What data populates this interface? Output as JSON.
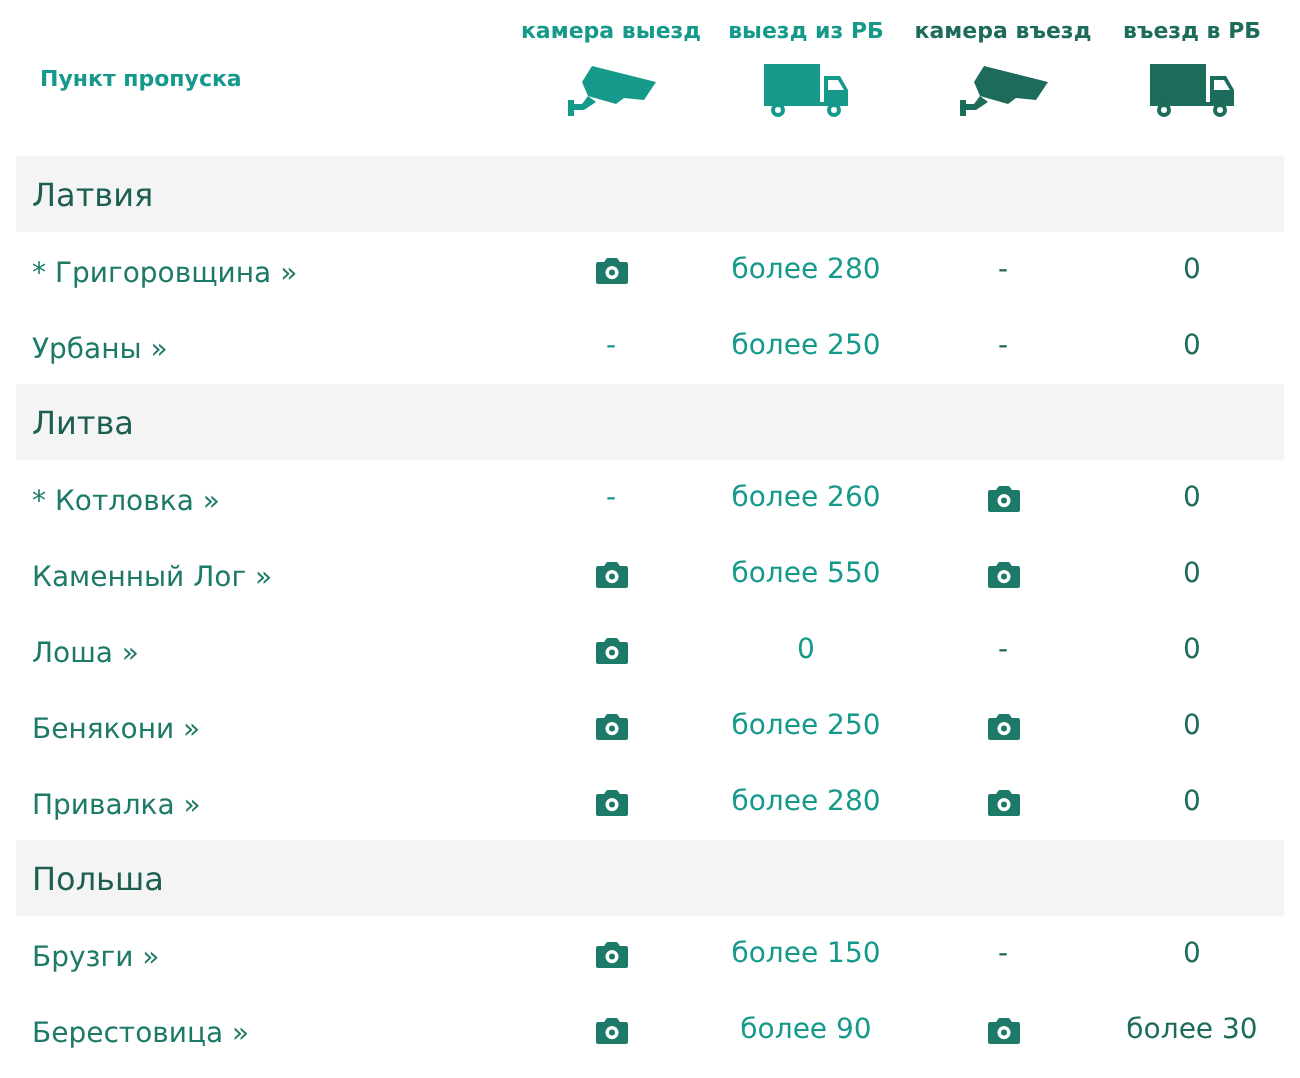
{
  "table": {
    "columns": [
      {
        "label": "Пункт пропуска",
        "kind": "name"
      },
      {
        "label": "камера выезд",
        "kind": "camera",
        "color": "#14998a"
      },
      {
        "label": "выезд из РБ",
        "kind": "truck",
        "color": "#14998a"
      },
      {
        "label": "камера въезд",
        "kind": "camera",
        "color": "#1d6b5a"
      },
      {
        "label": "въезд в РБ",
        "kind": "truck",
        "color": "#1d6b5a"
      }
    ],
    "groups": [
      {
        "name": "Латвия",
        "rows": [
          {
            "name": "* Григоровщина »",
            "cells": [
              {
                "kind": "camera"
              },
              {
                "kind": "text",
                "text": "более 280"
              },
              {
                "kind": "text",
                "text": "-"
              },
              {
                "kind": "text",
                "text": "0"
              }
            ]
          },
          {
            "name": "Урбаны »",
            "cells": [
              {
                "kind": "text",
                "text": "-"
              },
              {
                "kind": "text",
                "text": "более 250"
              },
              {
                "kind": "text",
                "text": "-"
              },
              {
                "kind": "text",
                "text": "0"
              }
            ]
          }
        ]
      },
      {
        "name": "Литва",
        "rows": [
          {
            "name": "* Котловка »",
            "cells": [
              {
                "kind": "text",
                "text": "-"
              },
              {
                "kind": "text",
                "text": "более 260"
              },
              {
                "kind": "camera"
              },
              {
                "kind": "text",
                "text": "0"
              }
            ]
          },
          {
            "name": "Каменный Лог »",
            "cells": [
              {
                "kind": "camera"
              },
              {
                "kind": "text",
                "text": "более 550"
              },
              {
                "kind": "camera"
              },
              {
                "kind": "text",
                "text": "0"
              }
            ]
          },
          {
            "name": "Лоша »",
            "cells": [
              {
                "kind": "camera"
              },
              {
                "kind": "text",
                "text": "0"
              },
              {
                "kind": "text",
                "text": "-"
              },
              {
                "kind": "text",
                "text": "0"
              }
            ]
          },
          {
            "name": "Бенякони »",
            "cells": [
              {
                "kind": "camera"
              },
              {
                "kind": "text",
                "text": "более 250"
              },
              {
                "kind": "camera"
              },
              {
                "kind": "text",
                "text": "0"
              }
            ]
          },
          {
            "name": "Привалка »",
            "cells": [
              {
                "kind": "camera"
              },
              {
                "kind": "text",
                "text": "более 280"
              },
              {
                "kind": "camera"
              },
              {
                "kind": "text",
                "text": "0"
              }
            ]
          }
        ]
      },
      {
        "name": "Польша",
        "rows": [
          {
            "name": "Брузги »",
            "cells": [
              {
                "kind": "camera"
              },
              {
                "kind": "text",
                "text": "более 150"
              },
              {
                "kind": "text",
                "text": "-"
              },
              {
                "kind": "text",
                "text": "0"
              }
            ]
          },
          {
            "name": "Берестовица »",
            "cells": [
              {
                "kind": "camera"
              },
              {
                "kind": "text",
                "text": "более 90"
              },
              {
                "kind": "camera"
              },
              {
                "kind": "text",
                "text": "более 30"
              }
            ]
          }
        ]
      }
    ]
  }
}
